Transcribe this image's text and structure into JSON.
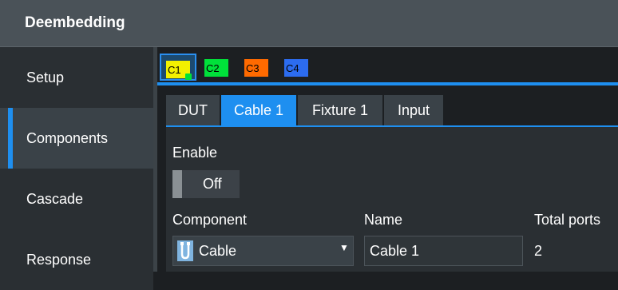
{
  "window": {
    "title": "Deembedding"
  },
  "sidebar": {
    "items": [
      {
        "label": "Setup",
        "active": false
      },
      {
        "label": "Components",
        "active": true
      },
      {
        "label": "Cascade",
        "active": false
      },
      {
        "label": "Response",
        "active": false
      }
    ]
  },
  "channel_tabs": [
    {
      "label": "C1",
      "color": "#f2f000",
      "active": true
    },
    {
      "label": "C2",
      "color": "#00e13a",
      "active": false
    },
    {
      "label": "C3",
      "color": "#ff6a00",
      "active": false
    },
    {
      "label": "C4",
      "color": "#2c6cf0",
      "active": false
    }
  ],
  "sub_tabs": [
    {
      "label": "DUT",
      "active": false
    },
    {
      "label": "Cable 1",
      "active": true
    },
    {
      "label": "Fixture 1",
      "active": false
    },
    {
      "label": "Input",
      "active": false
    }
  ],
  "panel": {
    "enable_label": "Enable",
    "enable_state": "Off",
    "component_label": "Component",
    "component_value": "Cable",
    "component_icon": "cable-icon",
    "name_label": "Name",
    "name_value": "Cable 1",
    "total_ports_label": "Total ports",
    "total_ports_value": "2"
  },
  "colors": {
    "accent": "#1e8ff0",
    "title_bar": "#4a5258",
    "sidebar": "#2a2f33"
  }
}
